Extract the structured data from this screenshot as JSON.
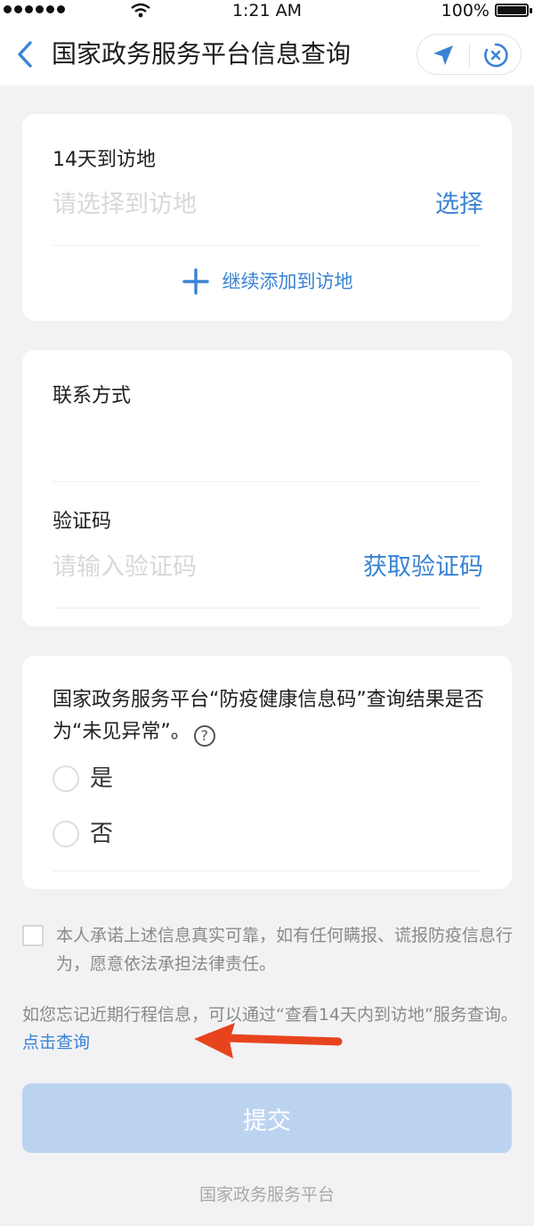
{
  "status_bar": {
    "time": "1:21 AM",
    "battery": "100%",
    "icons": [
      "signal-dots-icon",
      "wifi-icon",
      "battery-icon"
    ]
  },
  "nav": {
    "title": "国家政务服务平台信息查询",
    "icons": [
      "back-chevron-icon",
      "location-arrow-icon",
      "close-circle-icon"
    ],
    "accent": "#3a83d4"
  },
  "visit_card": {
    "label": "14天到访地",
    "placeholder": "请选择到访地",
    "select_label": "选择",
    "add_label": "继续添加到访地"
  },
  "contact_card": {
    "contact_label": "联系方式",
    "contact_value": "",
    "code_label": "验证码",
    "code_placeholder": "请输入验证码",
    "get_code_label": "获取验证码"
  },
  "question_card": {
    "question": "国家政务服务平台“防疫健康信息码”查询结果是否为“未见异常”。",
    "help_symbol": "?",
    "options": [
      "是",
      "否"
    ]
  },
  "pledge": {
    "text": "本人承诺上述信息真实可靠，如有任何瞒报、谎报防疫信息行为，愿意依法承担法律责任。"
  },
  "hint": {
    "text": "如您忘记近期行程信息，可以通过“查看14天内到访地”服务查询。",
    "link": "点击查询",
    "arrow_color": "#e8431f"
  },
  "submit": {
    "label": "提交",
    "color": "#bcd3f0"
  },
  "footer": {
    "text": "国家政务服务平台"
  }
}
